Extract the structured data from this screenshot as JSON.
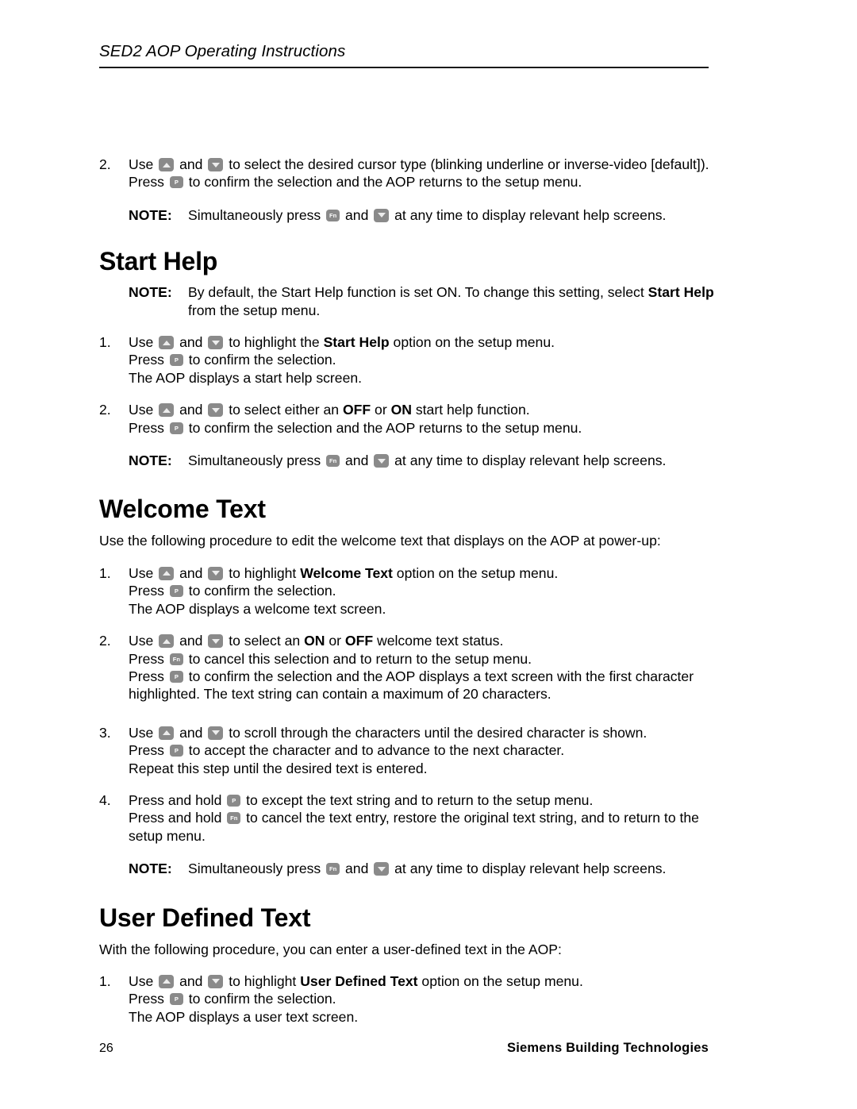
{
  "header": {
    "title": "SED2 AOP Operating Instructions"
  },
  "keys": {
    "up": "up-arrow-key",
    "down": "down-arrow-key",
    "p": "P",
    "fn": "Fn"
  },
  "top_item": {
    "number": "2.",
    "line1_a": "Use ",
    "line1_b": " and ",
    "line1_c": " to select the desired cursor type (blinking underline or inverse-video [default]).",
    "line2_a": "Press ",
    "line2_b": " to confirm the selection and the AOP returns to the setup menu."
  },
  "note": {
    "label": "NOTE:",
    "press_a": "Simultaneously press ",
    "press_b": " and ",
    "press_c": " at any time to display relevant help screens."
  },
  "sections": {
    "start_help": {
      "heading": "Start Help",
      "note_label": "NOTE:",
      "note_a": "By default, the Start Help function is set ON. To change this setting, select ",
      "note_bold1": "Start Help",
      "note_b": " from the setup menu.",
      "items": [
        {
          "number": "1.",
          "l1_a": "Use ",
          "l1_b": " and ",
          "l1_c": " to highlight the ",
          "l1_bold": "Start Help",
          "l1_d": " option on the setup menu.",
          "l2_a": "Press ",
          "l2_b": " to confirm the selection.",
          "l3": "The AOP displays a start help screen."
        },
        {
          "number": "2.",
          "l1_a": "Use ",
          "l1_b": " and ",
          "l1_c": " to select either an ",
          "l1_bold1": "OFF",
          "l1_d": " or ",
          "l1_bold2": "ON",
          "l1_e": " start help function.",
          "l2_a": "Press ",
          "l2_b": " to confirm the selection and the AOP returns to the setup menu."
        }
      ]
    },
    "welcome_text": {
      "heading": "Welcome Text",
      "intro": "Use the following procedure to edit the welcome text that displays on the AOP at power-up:",
      "items": [
        {
          "number": "1.",
          "l1_a": "Use ",
          "l1_b": " and ",
          "l1_c": " to highlight ",
          "l1_bold": "Welcome Text",
          "l1_d": " option on the setup menu.",
          "l2_a": "Press ",
          "l2_b": " to confirm the selection.",
          "l3": "The AOP displays a welcome text screen."
        },
        {
          "number": "2.",
          "l1_a": "Use ",
          "l1_b": " and ",
          "l1_c": " to select an ",
          "l1_bold1": "ON",
          "l1_d": " or ",
          "l1_bold2": "OFF",
          "l1_e": " welcome text status.",
          "l2_a": "Press ",
          "l2_b": " to cancel this selection and to return to the setup menu.",
          "l3_a": "Press ",
          "l3_b": " to confirm the selection and the AOP displays a text screen with the first character highlighted. The text string can contain a maximum of 20 characters."
        },
        {
          "number": "3.",
          "l1_a": "Use ",
          "l1_b": " and ",
          "l1_c": " to scroll through the characters until the desired character is shown.",
          "l2_a": "Press ",
          "l2_b": " to accept the character and to advance to the next character.",
          "l3": "Repeat this step until the desired text is entered."
        },
        {
          "number": "4.",
          "l1_a": "Press and hold ",
          "l1_b": " to except the text string and to return to the setup menu.",
          "l2_a": "Press and hold ",
          "l2_b": " to cancel the text entry, restore the original text string, and to return to the setup menu."
        }
      ]
    },
    "user_defined_text": {
      "heading": "User Defined Text",
      "intro": "With the following procedure, you can enter a user-defined text in the AOP:",
      "items": [
        {
          "number": "1.",
          "l1_a": "Use ",
          "l1_b": " and ",
          "l1_c": " to highlight ",
          "l1_bold": "User Defined Text",
          "l1_d": " option on the setup menu.",
          "l2_a": "Press ",
          "l2_b": " to confirm the selection.",
          "l3": "The AOP displays a user text screen."
        }
      ]
    }
  },
  "footer": {
    "page_number": "26",
    "brand": "Siemens Building Technologies"
  }
}
